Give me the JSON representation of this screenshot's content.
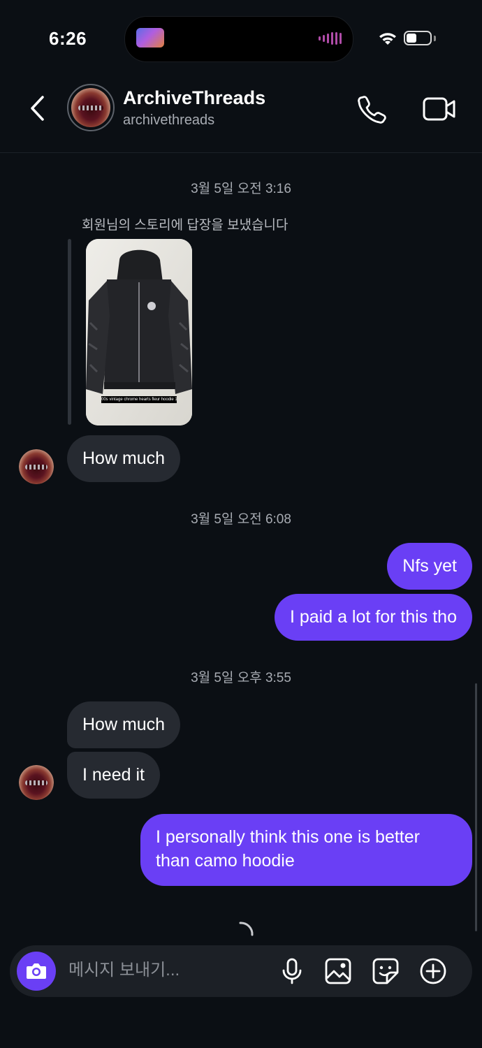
{
  "status_bar": {
    "time": "6:26"
  },
  "header": {
    "name": "ArchiveThreads",
    "handle": "archivethreads",
    "icons": [
      "back-icon",
      "phone-icon",
      "video-call-icon"
    ]
  },
  "thread": {
    "timestamps": [
      "3월 5일 오전 3:16",
      "3월 5일 오전 6:08",
      "3월 5일 오후 3:55"
    ],
    "story_reply_note": "회원님의 스토리에 답장을 보냈습니다",
    "story_caption": "00s vintage chrome hearts fleur hoodie 1 of 1",
    "messages": [
      {
        "sender": "them",
        "text": "How much"
      },
      {
        "sender": "me",
        "text": "Nfs yet"
      },
      {
        "sender": "me",
        "text": "I paid a lot for this tho"
      },
      {
        "sender": "them",
        "text": "How much"
      },
      {
        "sender": "them",
        "text": "I need it"
      },
      {
        "sender": "me",
        "text": "I personally think this one is better"
      },
      {
        "sender": "me",
        "text": "than camo hoodie"
      }
    ]
  },
  "composer": {
    "placeholder": "메시지 보내기...",
    "icons": [
      "camera-icon",
      "microphone-icon",
      "gallery-icon",
      "sticker-icon",
      "plus-icon"
    ]
  },
  "colors": {
    "background": "#0b0f14",
    "incoming_bubble": "#262a31",
    "outgoing_bubble": "#6a3ff5",
    "accent": "#6a3ff5"
  }
}
